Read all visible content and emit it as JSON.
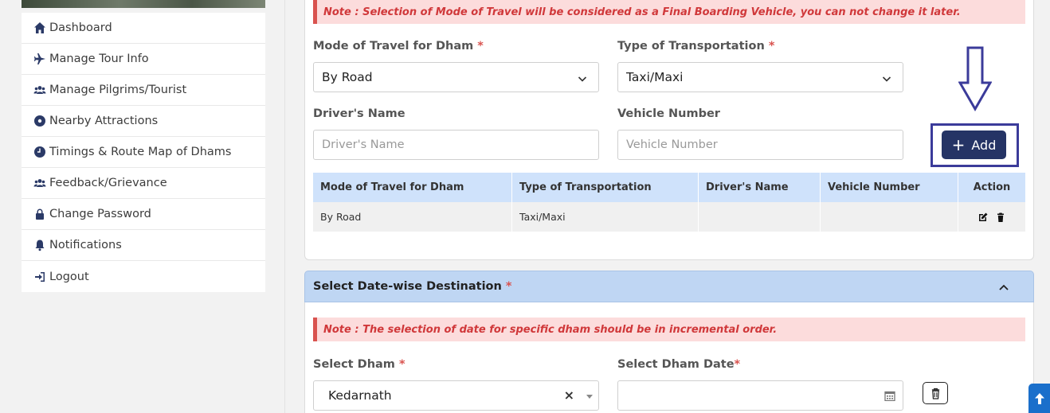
{
  "sidebar": {
    "items": [
      {
        "label": "Dashboard",
        "icon": "home-icon"
      },
      {
        "label": "Manage Tour Info",
        "icon": "plane-icon"
      },
      {
        "label": "Manage Pilgrims/Tourist",
        "icon": "users-icon"
      },
      {
        "label": "Nearby Attractions",
        "icon": "compass-icon"
      },
      {
        "label": "Timings & Route Map of Dhams",
        "icon": "clock-icon"
      },
      {
        "label": "Feedback/Grievance",
        "icon": "users-icon"
      },
      {
        "label": "Change Password",
        "icon": "lock-icon"
      },
      {
        "label": "Notifications",
        "icon": "bell-icon"
      },
      {
        "label": "Logout",
        "icon": "logout-icon"
      }
    ]
  },
  "travel": {
    "note": "Note : Selection of Mode of Travel will be considered as a Final Boarding Vehicle, you can not change it later.",
    "mode_label": "Mode of Travel for Dham",
    "mode_value": "By Road",
    "type_label": "Type of Transportation",
    "type_value": "Taxi/Maxi",
    "driver_label": "Driver's Name",
    "driver_placeholder": "Driver's Name",
    "vehicle_label": "Vehicle Number",
    "vehicle_placeholder": "Vehicle Number",
    "add_label": "Add",
    "required_mark": "*"
  },
  "table": {
    "headers": [
      "Mode of Travel for Dham",
      "Type of Transportation",
      "Driver's Name",
      "Vehicle Number",
      "Action"
    ],
    "rows": [
      {
        "mode": "By Road",
        "type": "Taxi/Maxi",
        "driver": "",
        "vehicle": ""
      }
    ]
  },
  "destination": {
    "title": "Select Date-wise Destination",
    "required_mark": "*",
    "note": "Note : The selection of date for specific dham should be in incremental order.",
    "dham_label": "Select Dham",
    "dham_value": "Kedarnath",
    "date_label": "Select Dham Date",
    "clear_glyph": "×"
  },
  "colors": {
    "primary": "#253465",
    "note_bg": "#fcdcdc",
    "note_text": "#d0383a",
    "table_head_bg": "#cfe2fb",
    "section_head_bg": "#bfd6f3",
    "annotation_frame": "#3b3b9a",
    "scroll_top_bg": "#1a6fcb"
  }
}
